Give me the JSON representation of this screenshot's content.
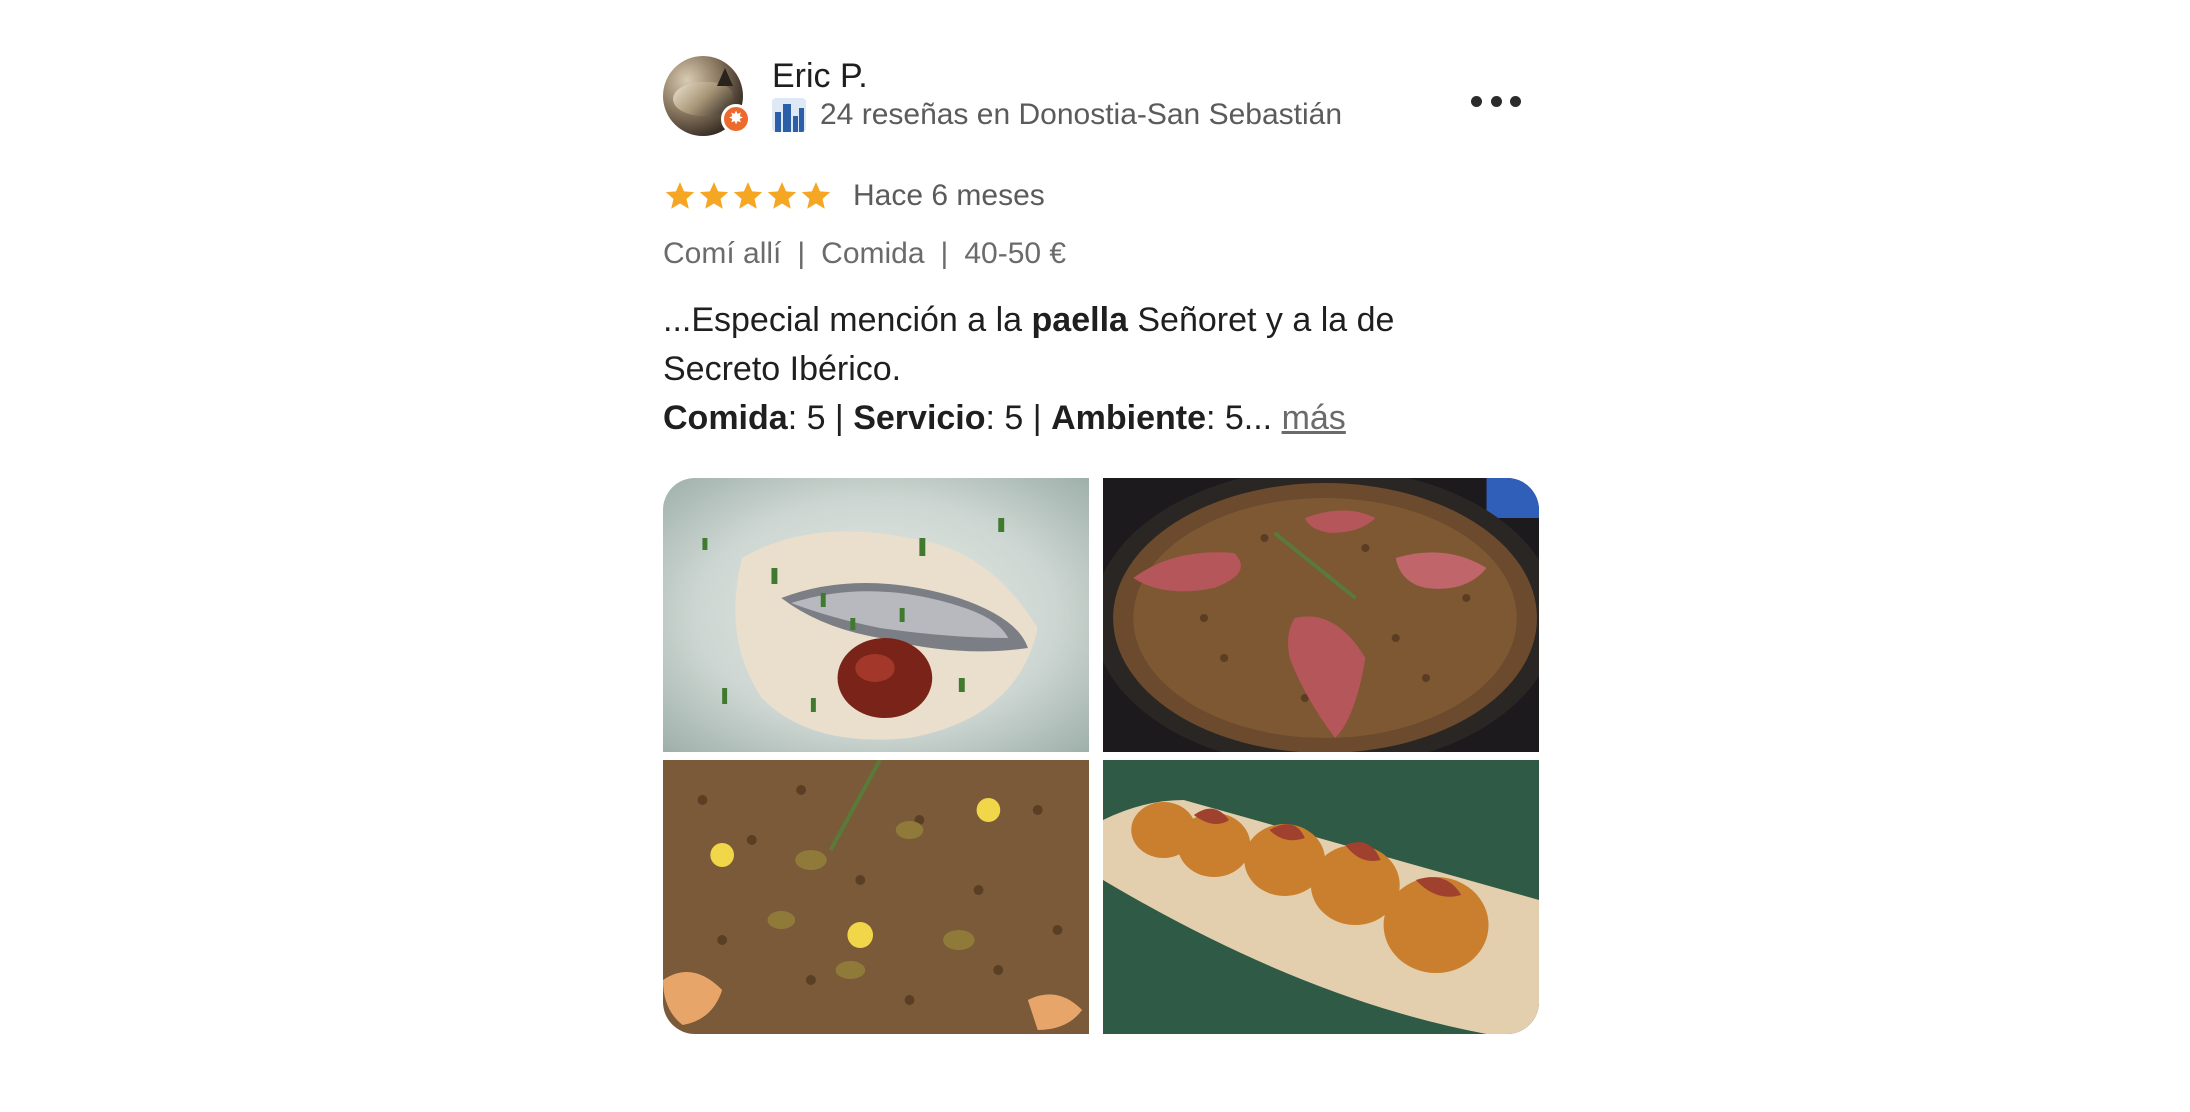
{
  "review": {
    "user": {
      "name": "Eric P.",
      "reviews_text": "24 reseñas en Donostia-San Sebastián",
      "avatar_icon": "user-avatar",
      "badge_icon": "elite-badge-icon",
      "city_icon": "city-skyline-icon"
    },
    "more_options_icon": "more-horizontal-icon",
    "rating": 5,
    "rating_max": 5,
    "star_color": "#f5a623",
    "time_ago": "Hace 6 meses",
    "tags": [
      "Comí allí",
      "Comida",
      "40-50 €"
    ],
    "text": {
      "line1_prefix": "...Especial mención a la ",
      "line1_bold": "paella",
      "line1_suffix": " Señoret y a la de",
      "line2": "Secreto Ibérico.",
      "line3_label1": "Comida",
      "line3_value1": ": 5 | ",
      "line3_label2": "Servicio",
      "line3_value2": ": 5 | ",
      "line3_label3": "Ambiente",
      "line3_value3": ": 5... ",
      "more_link": "más"
    },
    "photos": [
      {
        "name": "photo-anchovy-toast"
      },
      {
        "name": "photo-paella-iberico"
      },
      {
        "name": "photo-paella-seafood"
      },
      {
        "name": "photo-croquetas"
      }
    ]
  }
}
